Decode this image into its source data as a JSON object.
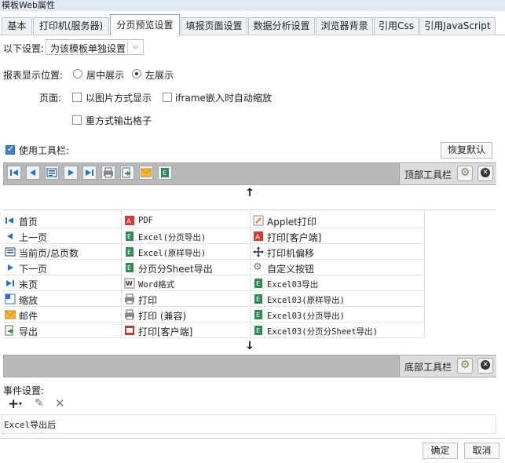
{
  "window": {
    "title": "模板Web属性"
  },
  "tabs": [
    {
      "label": "基本"
    },
    {
      "label": "打印机(服务器)"
    },
    {
      "label": "分页预览设置"
    },
    {
      "label": "填报页面设置"
    },
    {
      "label": "数据分析设置"
    },
    {
      "label": "浏览器背景"
    },
    {
      "label": "引用Css"
    },
    {
      "label": "引用JavaScript"
    }
  ],
  "settings": {
    "scope_label": "以下设置:",
    "scope_value": "为该模板单独设置",
    "position_label": "报表显示位置:",
    "position_options": [
      "居中展示",
      "左展示"
    ],
    "position_selected": "左展示",
    "page_label": "页面:",
    "page_options": [
      "以图片方式显示",
      "iframe嵌入时自动缩放",
      "重方式输出格子"
    ],
    "use_toolbar_label": "使用工具栏:",
    "use_toolbar_checked": true,
    "restore_label": "恢复默认"
  },
  "top_toolbar": {
    "label": "顶部工具栏",
    "icons": [
      "first-page-icon",
      "prev-page-icon",
      "page-count-icon",
      "next-page-icon",
      "last-page-icon",
      "print-icon",
      "export-icon",
      "email-icon",
      "excel-icon"
    ]
  },
  "bottom_toolbar": {
    "label": "底部工具栏"
  },
  "buttons_grid": {
    "col1": [
      {
        "label": "首页",
        "icon": "first-page-icon"
      },
      {
        "label": "上一页",
        "icon": "prev-page-icon"
      },
      {
        "label": "当前页/总页数",
        "icon": "page-count-icon"
      },
      {
        "label": "下一页",
        "icon": "next-page-icon"
      },
      {
        "label": "末页",
        "icon": "last-page-icon"
      },
      {
        "label": "缩放",
        "icon": "zoom-icon"
      },
      {
        "label": "邮件",
        "icon": "email-icon"
      },
      {
        "label": "导出",
        "icon": "export-icon"
      }
    ],
    "col2": [
      {
        "label": "PDF",
        "icon": "pdf-icon"
      },
      {
        "label": "Excel(分页导出)",
        "icon": "excel-icon"
      },
      {
        "label": "Excel(原样导出)",
        "icon": "excel-icon"
      },
      {
        "label": "分页分Sheet导出",
        "icon": "excel-icon"
      },
      {
        "label": "Word格式",
        "icon": "word-icon"
      },
      {
        "label": "打印",
        "icon": "print-icon"
      },
      {
        "label": "打印 (兼容)",
        "icon": "print-icon"
      },
      {
        "label": "打印[客户端]",
        "icon": "print-client-icon"
      }
    ],
    "col3": [
      {
        "label": "Applet打印",
        "icon": "applet-print-icon"
      },
      {
        "label": "打印[客户端]",
        "icon": "pdf-icon"
      },
      {
        "label": "打印机偏移",
        "icon": "move-icon"
      },
      {
        "label": "自定义按钮",
        "icon": "gear-icon"
      },
      {
        "label": "Excel03导出",
        "icon": "excel-icon"
      },
      {
        "label": "Excel03(原样导出)",
        "icon": "excel-icon"
      },
      {
        "label": "Excel03(分页导出)",
        "icon": "excel-icon"
      },
      {
        "label": "Excel03(分页分Sheet导出)",
        "icon": "excel-icon"
      }
    ]
  },
  "events": {
    "label": "事件设置:",
    "items": [
      "Excel导出后"
    ]
  },
  "footer": {
    "ok": "确定",
    "cancel": "取消"
  }
}
